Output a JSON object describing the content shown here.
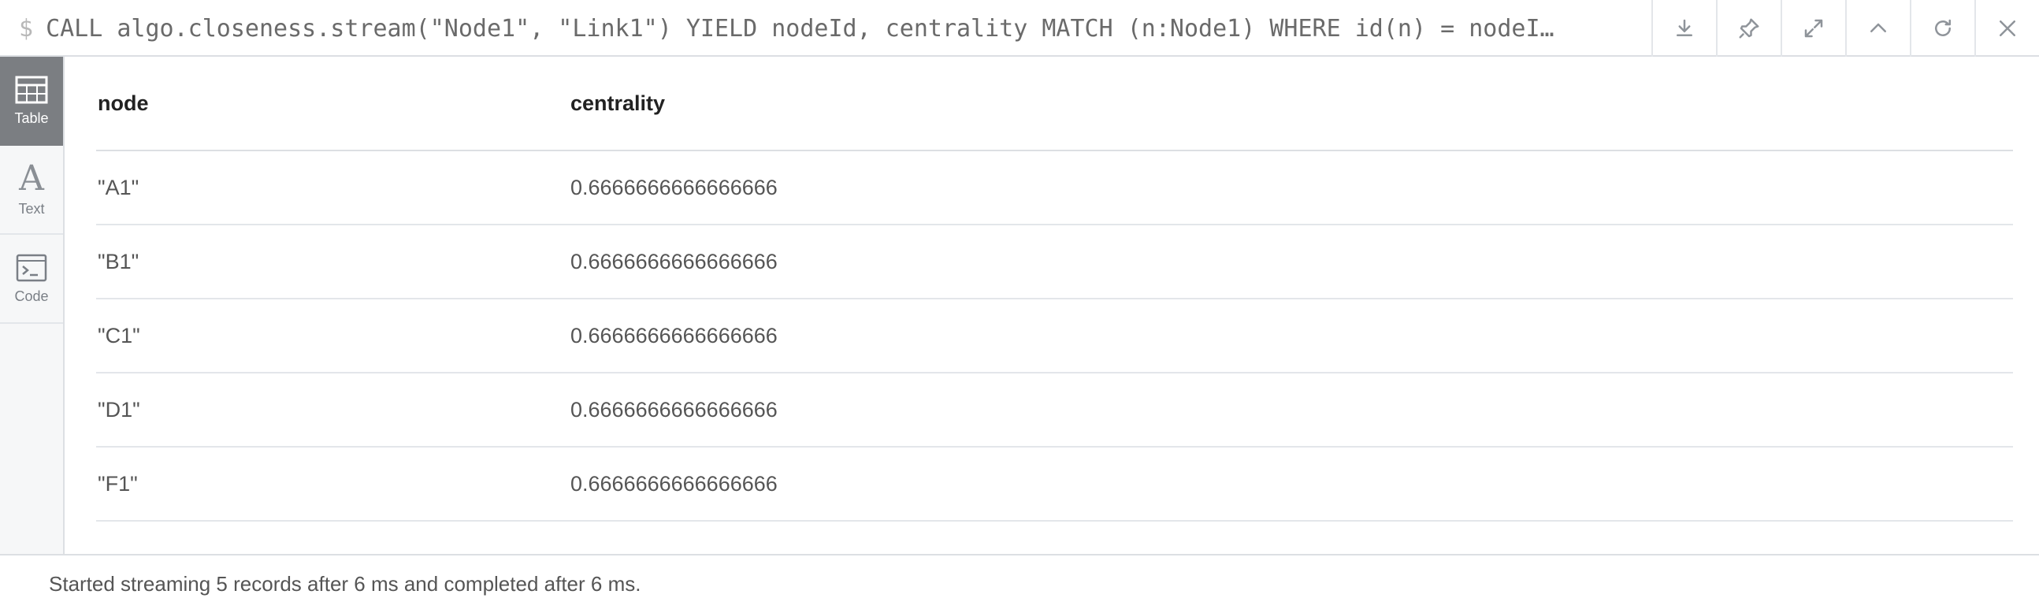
{
  "query": {
    "prompt": "$",
    "text": "CALL algo.closeness.stream(\"Node1\", \"Link1\")  YIELD nodeId, centrality  MATCH (n:Node1) WHERE id(n) = nodeI…"
  },
  "toolbar": {
    "icons": [
      "download-icon",
      "pin-icon",
      "expand-icon",
      "collapse-up-icon",
      "refresh-icon",
      "close-icon"
    ]
  },
  "sidebar": {
    "items": [
      {
        "label": "Table",
        "icon": "table-icon",
        "active": true
      },
      {
        "label": "Text",
        "icon": "text-icon",
        "active": false
      },
      {
        "label": "Code",
        "icon": "code-icon",
        "active": false
      }
    ]
  },
  "table": {
    "columns": [
      "node",
      "centrality"
    ],
    "rows": [
      [
        "\"A1\"",
        "0.6666666666666666"
      ],
      [
        "\"B1\"",
        "0.6666666666666666"
      ],
      [
        "\"C1\"",
        "0.6666666666666666"
      ],
      [
        "\"D1\"",
        "0.6666666666666666"
      ],
      [
        "\"F1\"",
        "0.6666666666666666"
      ]
    ]
  },
  "footer": {
    "status": "Started streaming 5 records after 6 ms and completed after 6 ms."
  },
  "colors": {
    "active_tab_bg": "#7b7e82",
    "sidebar_bg": "#f6f7f8",
    "border": "#dcdfe3"
  }
}
